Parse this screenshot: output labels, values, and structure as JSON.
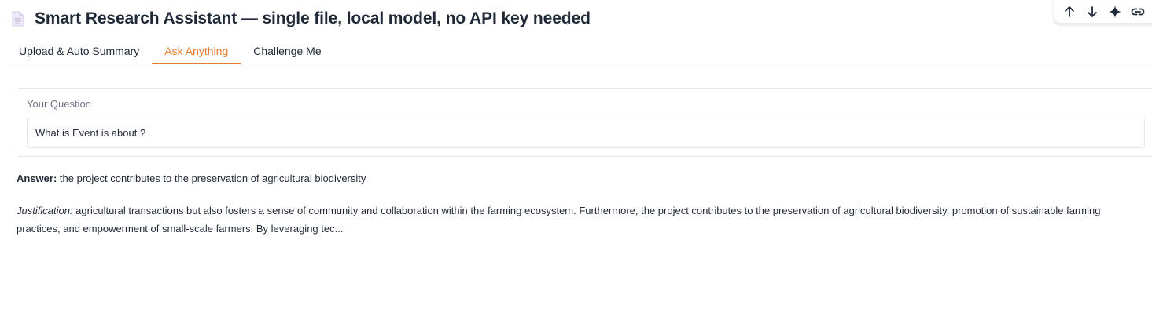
{
  "header": {
    "title": "Smart Research Assistant — single file, local model, no API key needed",
    "icon": "document-icon"
  },
  "toolbar": {
    "buttons": [
      {
        "icon": "arrow-up-icon"
      },
      {
        "icon": "arrow-down-icon"
      },
      {
        "icon": "sparkle-icon"
      },
      {
        "icon": "link-icon"
      }
    ]
  },
  "tabs": [
    {
      "label": "Upload & Auto Summary",
      "active": false
    },
    {
      "label": "Ask Anything",
      "active": true
    },
    {
      "label": "Challenge Me",
      "active": false
    }
  ],
  "question": {
    "label": "Your Question",
    "value": "What is Event is about ?"
  },
  "answer": {
    "prefix": "Answer:",
    "text": " the project contributes to the preservation of agricultural biodiversity"
  },
  "justification": {
    "prefix": "Justification:",
    "text": " agricultural transactions but also fosters a sense of community and collaboration within the farming ecosystem. Furthermore, the project contributes to the preservation of agricultural biodiversity, promotion of sustainable farming practices, and empowerment of small-scale farmers. By leveraging tec..."
  },
  "colors": {
    "accent": "#ea7b2c",
    "text": "#1f2937",
    "muted": "#6b7280",
    "border": "#e5e7eb"
  }
}
